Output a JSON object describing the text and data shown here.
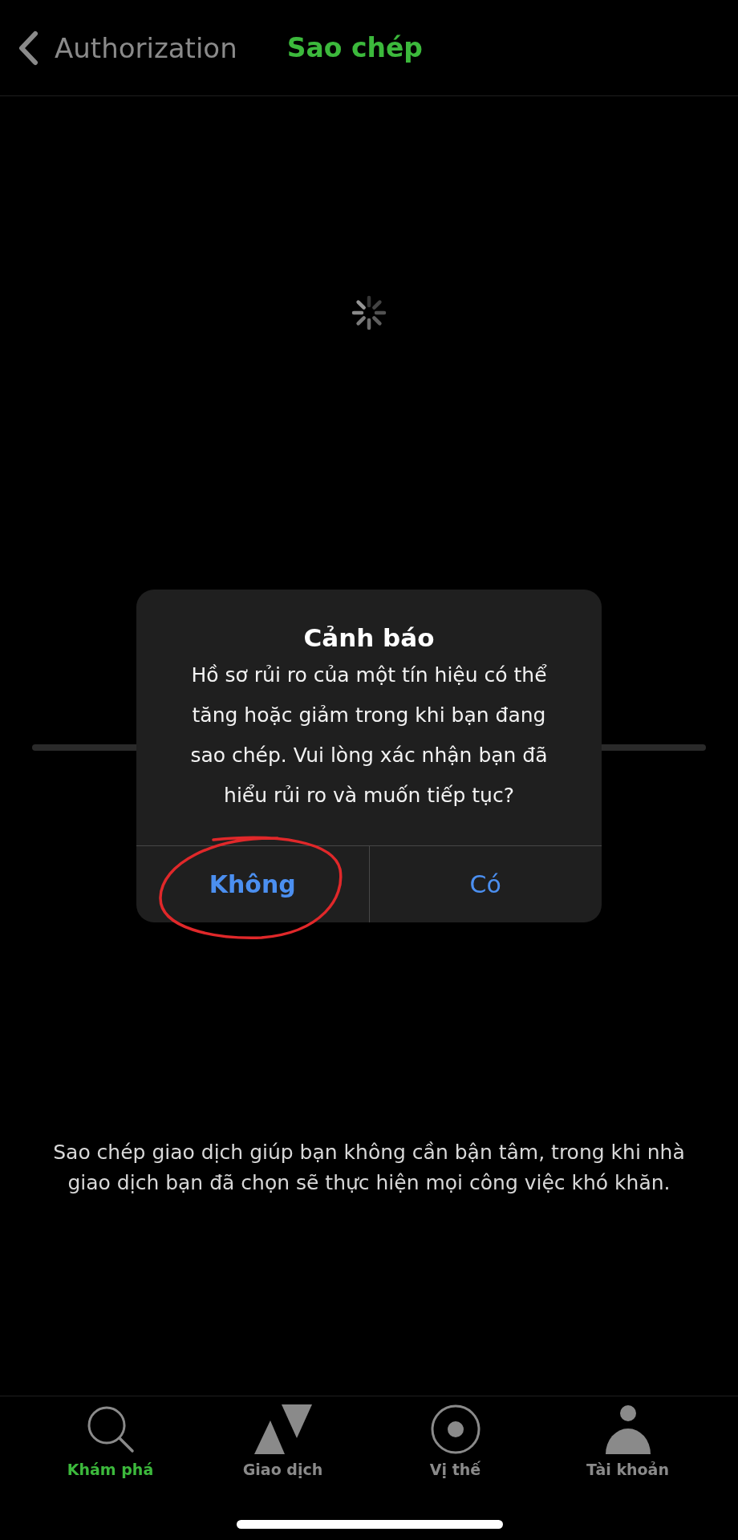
{
  "header": {
    "back_label": "Authorization",
    "title": "Sao chép"
  },
  "loading": true,
  "dialog": {
    "title": "Cảnh báo",
    "message": "Hồ sơ rủi ro của một tín hiệu có thể tăng hoặc giảm trong khi bạn đang sao chép. Vui lòng xác nhận bạn đã hiểu rủi ro và muốn tiếp tục?",
    "buttons": [
      {
        "label": "Không",
        "preferred": true,
        "circled": true
      },
      {
        "label": "Có",
        "preferred": false,
        "circled": false
      }
    ]
  },
  "description": "Sao chép giao dịch giúp bạn không cần bận tâm, trong khi nhà giao dịch bạn đã chọn sẽ thực hiện mọi công việc khó khăn.",
  "tabs": [
    {
      "label": "Khám phá",
      "kind": "search",
      "selected": true
    },
    {
      "label": "Giao dịch",
      "kind": "trade",
      "selected": false
    },
    {
      "label": "Vị thế",
      "kind": "position",
      "selected": false
    },
    {
      "label": "Tài khoản",
      "kind": "account",
      "selected": false
    }
  ]
}
